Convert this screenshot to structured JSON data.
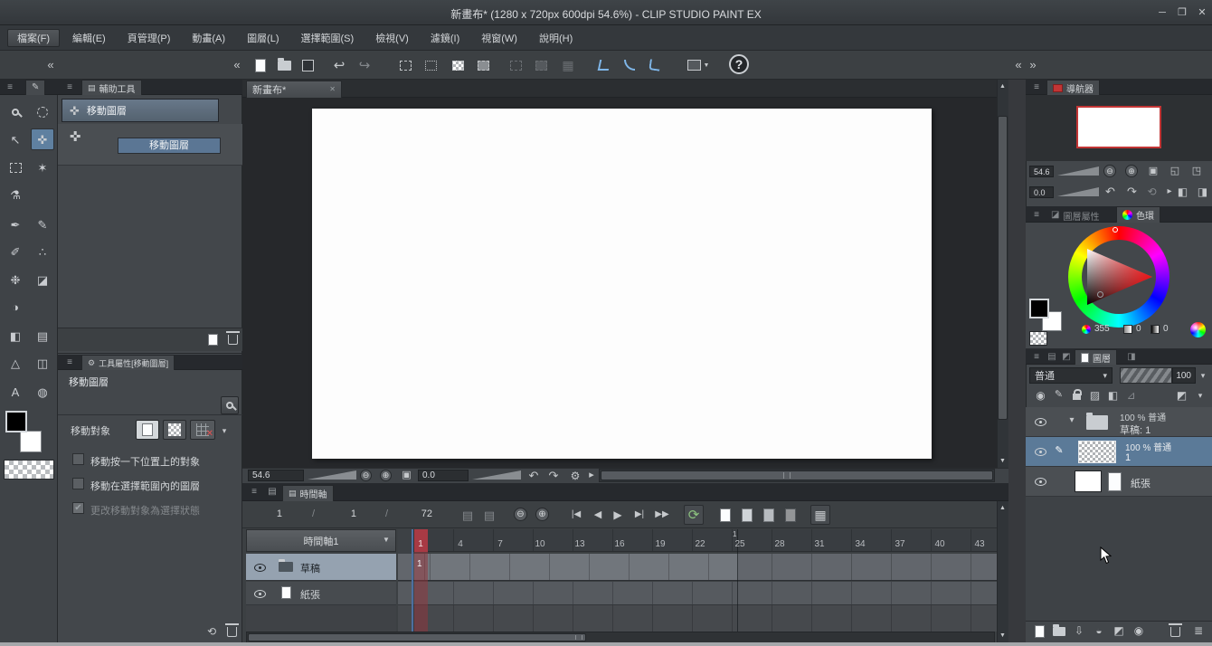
{
  "window": {
    "title": "新畫布* (1280 x 720px 600dpi 54.6%)  - CLIP STUDIO PAINT EX",
    "minimize_glyph": "─",
    "maximize_glyph": "❐",
    "close_glyph": "✕"
  },
  "glyphs": {
    "menu": "≡",
    "chev_l": "«",
    "chev_r": "»",
    "undo": "↩",
    "redo": "↪",
    "help": "?",
    "minus": "⊖",
    "plus": "⊕",
    "fit": "▣",
    "fit_w": "◱",
    "fit_a": "◳",
    "rot_l": "↶",
    "rot_r": "↷",
    "reset": "⟲",
    "arrow": "▸",
    "flip_h": "◧",
    "flip_v": "◨",
    "gear": "⚙",
    "caret": "▾",
    "up": "▲",
    "down": "▼",
    "check": "✔",
    "close": "✕",
    "loop": "⟳",
    "grid": "▦",
    "onion": "▤",
    "transfer": "⇩",
    "merge": "◒",
    "maskset": "◩",
    "list": "≣",
    "clip": "◉",
    "pen_small": "✎",
    "lock_t": "▨",
    "mask": "◧",
    "ruler_ic": "⊿",
    "expand": "▾",
    "film": "▤",
    "xmark": "✕"
  },
  "menu": {
    "items": [
      {
        "label": "檔案(F)"
      },
      {
        "label": "編輯(E)"
      },
      {
        "label": "頁管理(P)"
      },
      {
        "label": "動畫(A)"
      },
      {
        "label": "圖層(L)"
      },
      {
        "label": "選擇範圍(S)"
      },
      {
        "label": "檢視(V)"
      },
      {
        "label": "濾鏡(I)"
      },
      {
        "label": "視窗(W)"
      },
      {
        "label": "說明(H)"
      }
    ]
  },
  "tool_palette": {
    "tools": [
      {
        "name": "zoom",
        "glyph": ""
      },
      {
        "name": "lasso-select",
        "glyph": ""
      },
      {
        "name": "operate",
        "glyph": "↖"
      },
      {
        "name": "move-layer",
        "glyph": "✜"
      },
      {
        "name": "marquee",
        "glyph": ""
      },
      {
        "name": "auto-select",
        "glyph": "✶"
      },
      {
        "name": "eyedropper",
        "glyph": "⚗"
      },
      {
        "name": "pen",
        "glyph": "✒"
      },
      {
        "name": "pencil",
        "glyph": "✎"
      },
      {
        "name": "brush",
        "glyph": "✐"
      },
      {
        "name": "airbrush",
        "glyph": "∴"
      },
      {
        "name": "decoration",
        "glyph": "❉"
      },
      {
        "name": "eraser",
        "glyph": "◪"
      },
      {
        "name": "blend",
        "glyph": "◑"
      },
      {
        "name": "fill",
        "glyph": "◧"
      },
      {
        "name": "gradient",
        "glyph": "▤"
      },
      {
        "name": "figure",
        "glyph": "△"
      },
      {
        "name": "frame-border",
        "glyph": "◫"
      },
      {
        "name": "text",
        "glyph": "A"
      },
      {
        "name": "balloon",
        "glyph": "◍"
      }
    ],
    "main_color": "#000000",
    "sub_color": "#ffffff"
  },
  "subtool": {
    "tab": "輔助工具",
    "items": [
      {
        "label": "移動圖層"
      },
      {
        "label": "移動圖層"
      }
    ]
  },
  "tool_property": {
    "tab": "工具屬性[移動圖層]",
    "tool_name": "移動圖層",
    "target_label": "移動對象",
    "checkboxes": [
      {
        "label": "移動按一下位置上的對象",
        "checked": false
      },
      {
        "label": "移動在選擇範圍內的圖層",
        "checked": false
      },
      {
        "label": "更改移動對象為選擇狀態",
        "checked": true
      }
    ]
  },
  "canvas": {
    "tab": "新畫布*",
    "zoom": "54.6",
    "rotation": "0.0"
  },
  "timeline": {
    "tab": "時間軸",
    "current": "1",
    "sep": "/",
    "start": "1",
    "end": "72",
    "track": "時間軸1",
    "seconds_label": "1",
    "ruler": [
      "1",
      "4",
      "7",
      "10",
      "13",
      "16",
      "19",
      "22",
      "25",
      "28",
      "31",
      "34",
      "37",
      "40",
      "43"
    ],
    "rows": [
      {
        "name": "草稿",
        "cel": "1"
      },
      {
        "name": "紙張"
      }
    ],
    "transport": [
      {
        "name": "skip-to-start",
        "glyph": "|◀"
      },
      {
        "name": "prev-frame",
        "glyph": "◀"
      },
      {
        "name": "play",
        "glyph": "▶"
      },
      {
        "name": "next-frame",
        "glyph": "▶|"
      },
      {
        "name": "skip-to-end",
        "glyph": "▶▶"
      }
    ]
  },
  "navigator": {
    "tab": "導航器",
    "zoom": "54.6",
    "rotation": "0.0"
  },
  "color": {
    "tab_inactive": "圖層屬性",
    "tab_active": "色環",
    "hue": "355",
    "sat": "0",
    "val": "0"
  },
  "layers": {
    "tab": "圖層",
    "blend": "普通",
    "opacity": "100",
    "items": [
      {
        "info": "100 % 普通",
        "name": "草稿: 1"
      },
      {
        "info": "100 % 普通",
        "name": "1"
      },
      {
        "name": "紙張"
      }
    ]
  }
}
